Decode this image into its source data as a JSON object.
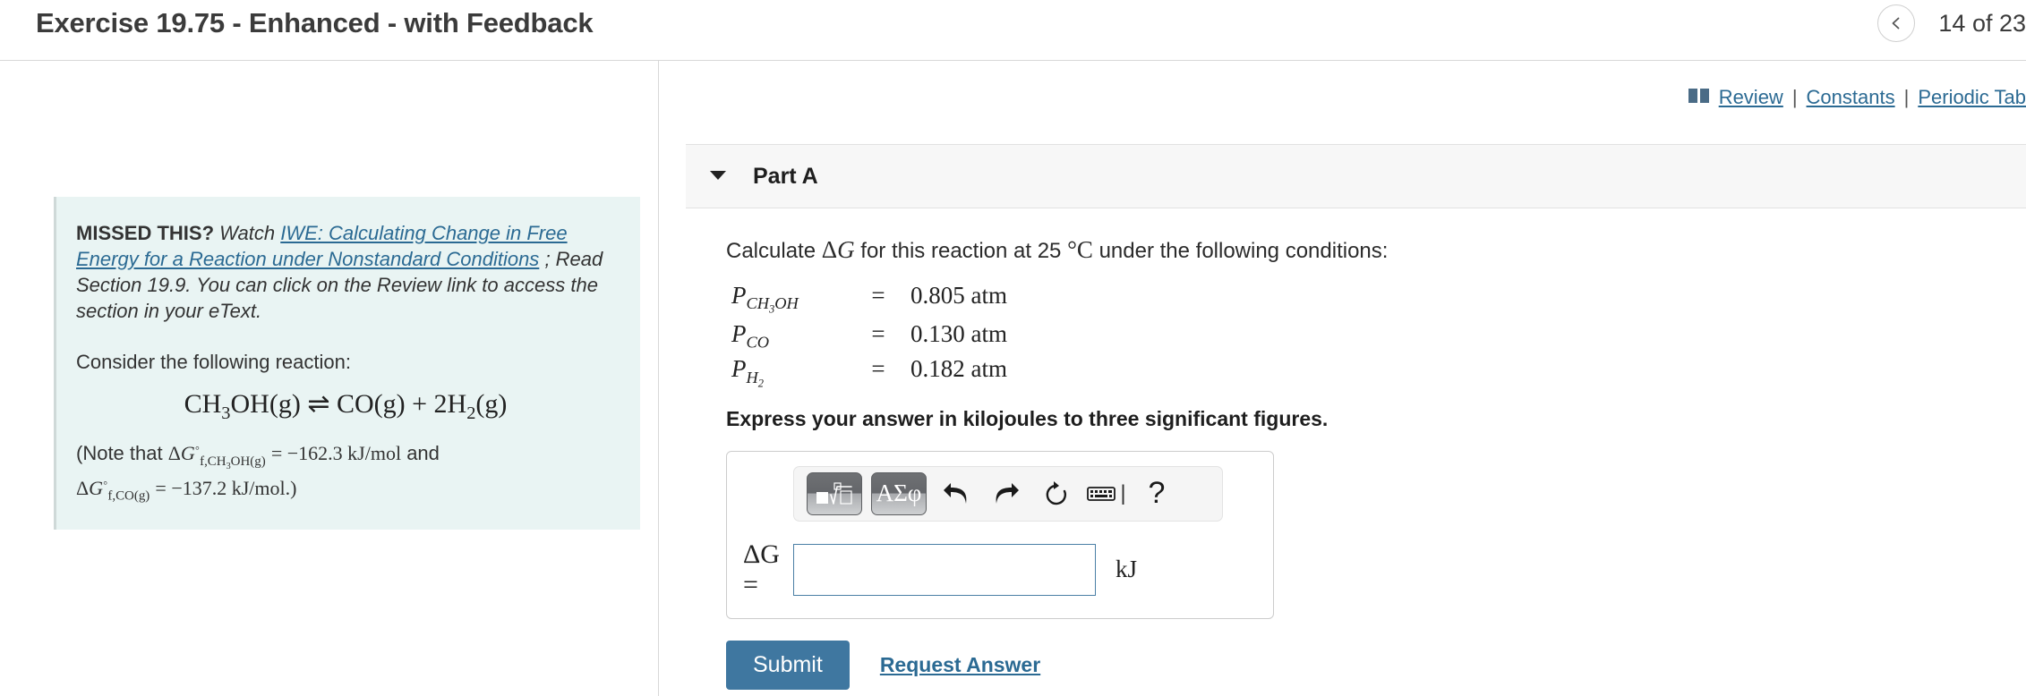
{
  "header": {
    "exercise_title": "Exercise 19.75 - Enhanced - with Feedback",
    "prev_icon": "chevron-left-icon",
    "page_counter": "14 of 23"
  },
  "resources": {
    "book_icon": "book-icon",
    "review_label": "Review",
    "separator": "|",
    "constants_label": "Constants",
    "periodic_label": "Periodic Tab"
  },
  "hint": {
    "missed_label": "MISSED THIS?",
    "watch_label": "Watch",
    "video_link": "IWE: Calculating Change in Free Energy for a Reaction under Nonstandard Conditions",
    "after_text": "; Read Section 19.9. You can click on the Review link to access the section in your eText.",
    "consider_label": "Consider the following reaction:",
    "reaction": {
      "reactant": "CH3OH(g)",
      "arrow": "⇌",
      "products": "CO(g) + 2H2(g)"
    },
    "note": {
      "prefix": "(Note that",
      "term1_symbol": "ΔG°f,CH3OH(g)",
      "term1_value": "−162.3 kJ/mol",
      "conjunction": "and",
      "term2_symbol": "ΔG°f,CO(g)",
      "term2_value": "−137.2 kJ/mol.)"
    }
  },
  "part": {
    "caret_icon": "caret-down-icon",
    "title": "Part A",
    "question_prefix": "Calculate",
    "question_symbol": "ΔG",
    "question_middle": "for this reaction at 25",
    "question_degree": "°C",
    "question_suffix": "under the following conditions:",
    "conditions": [
      {
        "symbol": "P",
        "subscript": "CH3OH",
        "equals": "=",
        "value": "0.805 atm"
      },
      {
        "symbol": "P",
        "subscript": "CO",
        "equals": "=",
        "value": "0.130 atm"
      },
      {
        "symbol": "P",
        "subscript": "H2",
        "equals": "=",
        "value": "0.182 atm"
      }
    ],
    "express_instruction": "Express your answer in kilojoules to three significant figures."
  },
  "answer": {
    "toolbar": {
      "template_button": "math-template-icon",
      "greek_button": "ΑΣφ",
      "undo_icon": "undo-arrow-icon",
      "redo_icon": "redo-arrow-icon",
      "reset_icon": "reset-circle-icon",
      "keyboard_icon": "keyboard-icon",
      "help_icon": "?"
    },
    "field_label": "ΔG =",
    "field_value": "",
    "field_placeholder": "",
    "unit": "kJ"
  },
  "actions": {
    "submit_label": "Submit",
    "request_answer_label": "Request Answer"
  },
  "colors": {
    "accent_blue": "#2b6a93",
    "submit_blue": "#3f77a0",
    "hint_background": "#e9f4f3",
    "part_header_background": "#f7f7f7",
    "input_border": "#4a7fa5"
  }
}
